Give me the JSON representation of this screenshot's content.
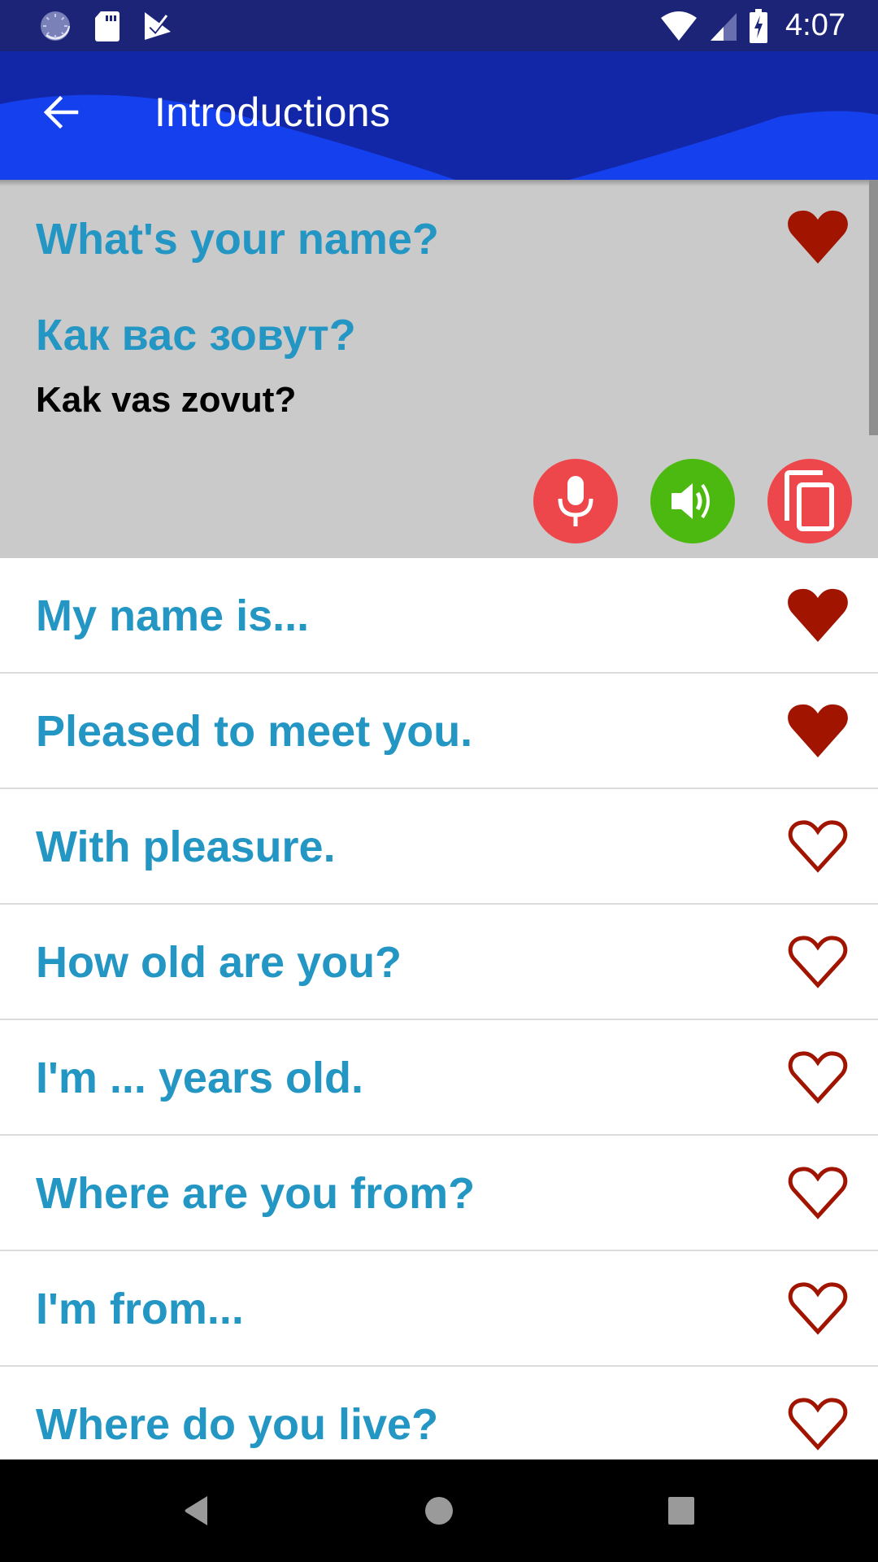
{
  "status_bar": {
    "time": "4:07",
    "left_icons": [
      "loading-spinner-icon",
      "sd-card-icon",
      "task-check-icon"
    ],
    "right_icons": [
      "wifi-icon",
      "cell-signal-icon",
      "battery-charging-icon"
    ]
  },
  "app_bar": {
    "title": "Introductions",
    "back_icon": "arrow-left-icon"
  },
  "colors": {
    "status_bar": "#1c2478",
    "app_bar_dark": "#1227a8",
    "app_bar_light": "#1540ee",
    "phrase_text": "#2496c4",
    "heart": "#a01400",
    "mic_button": "#ee474b",
    "speaker_button": "#4bb90f",
    "copy_button": "#ee474b",
    "expanded_bg": "#cacaca"
  },
  "expanded_phrase": {
    "english": "What's your name?",
    "russian": "Как вас зовут?",
    "transliteration": "Kak vas zovut?",
    "favorite": true,
    "actions": [
      {
        "name": "record",
        "icon": "microphone-icon"
      },
      {
        "name": "play",
        "icon": "speaker-icon"
      },
      {
        "name": "copy",
        "icon": "copy-icon"
      }
    ]
  },
  "phrases": [
    {
      "text": "My name is...",
      "favorite": true
    },
    {
      "text": "Pleased to meet you.",
      "favorite": true
    },
    {
      "text": "With pleasure.",
      "favorite": false
    },
    {
      "text": "How old are you?",
      "favorite": false
    },
    {
      "text": "I'm ... years old.",
      "favorite": false
    },
    {
      "text": "Where are you from?",
      "favorite": false
    },
    {
      "text": "I'm from...",
      "favorite": false
    },
    {
      "text": "Where do you live?",
      "favorite": false
    }
  ],
  "nav_bar": {
    "buttons": [
      "back",
      "home",
      "recents"
    ]
  }
}
